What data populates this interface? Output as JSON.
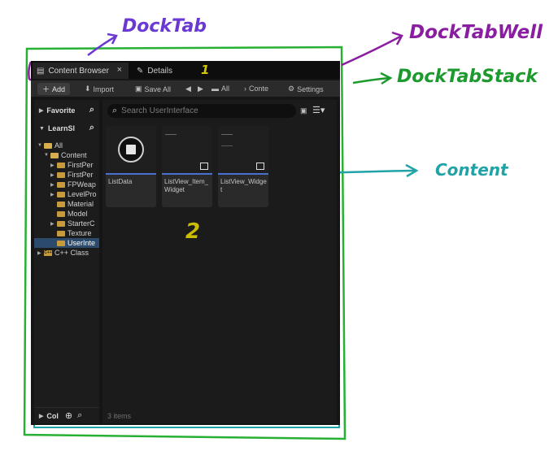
{
  "annotations": {
    "dock_tab": "DockTab",
    "dock_tab_well": "DockTabWell",
    "dock_tab_stack": "DockTabStack",
    "content": "Content",
    "marker_one": "1",
    "marker_two": "2"
  },
  "annotation_colors": {
    "dock_tab": "#6a38d2",
    "dock_tab_well": "#8a1ea0",
    "dock_tab_stack": "#1d9a2d",
    "content": "#20a3a6",
    "markers": "#d4c600",
    "tab_highlight": "#c8102e"
  },
  "tabs": [
    {
      "label": "Content Browser",
      "icon": "folder-icon",
      "active": true
    },
    {
      "label": "Details",
      "icon": "pencil-icon",
      "active": false
    }
  ],
  "toolbar": {
    "add_label": "Add",
    "import_label": "Import",
    "save_all_label": "Save All",
    "all_label": "All",
    "path_label": "Conte",
    "settings_label": "Settings"
  },
  "left_panel": {
    "favorites_label": "Favorite",
    "project_label": "LearnSl",
    "collections_label": "Col",
    "tree": [
      {
        "label": "All",
        "depth": 0,
        "expanded": true,
        "selected": false
      },
      {
        "label": "Content",
        "depth": 1,
        "expanded": true,
        "selected": false
      },
      {
        "label": "FirstPer",
        "depth": 2,
        "expanded": false,
        "selected": false
      },
      {
        "label": "FirstPer",
        "depth": 2,
        "expanded": false,
        "selected": false
      },
      {
        "label": "FPWeap",
        "depth": 2,
        "expanded": false,
        "selected": false
      },
      {
        "label": "LevelPro",
        "depth": 2,
        "expanded": false,
        "selected": false
      },
      {
        "label": "Material",
        "depth": 2,
        "expanded": null,
        "selected": false
      },
      {
        "label": "Model",
        "depth": 2,
        "expanded": null,
        "selected": false
      },
      {
        "label": "StarterC",
        "depth": 2,
        "expanded": false,
        "selected": false
      },
      {
        "label": "Texture",
        "depth": 2,
        "expanded": null,
        "selected": false
      },
      {
        "label": "UserInte",
        "depth": 2,
        "expanded": null,
        "selected": true
      },
      {
        "label": "C++ Class",
        "depth": 0,
        "expanded": false,
        "selected": false
      }
    ]
  },
  "content": {
    "search_placeholder": "Search UserInterface",
    "items": [
      {
        "name": "ListData",
        "kind": "data-asset"
      },
      {
        "name": "ListView_Item_Widget",
        "kind": "widget-blueprint"
      },
      {
        "name": "ListView_Widget",
        "kind": "widget-blueprint"
      }
    ],
    "item_count": "3 items"
  }
}
